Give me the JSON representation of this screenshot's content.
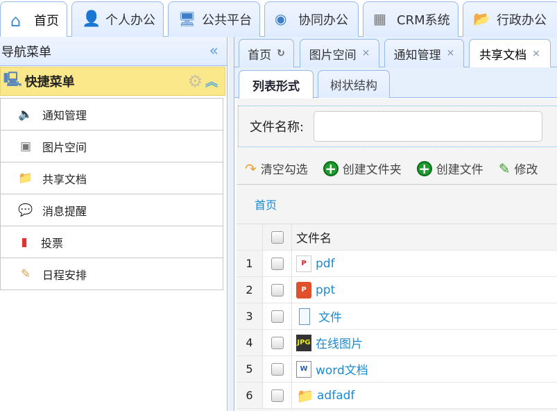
{
  "top_tabs": [
    "首页",
    "个人办公",
    "公共平台",
    "协同办公",
    "CRM系统",
    "行政办公"
  ],
  "left": {
    "title": "导航菜单",
    "quick_menu": "快捷菜单",
    "items": [
      "通知管理",
      "图片空间",
      "共享文档",
      "消息提醒",
      "投票",
      "日程安排"
    ]
  },
  "content_tabs": [
    "首页",
    "图片空间",
    "通知管理",
    "共享文档"
  ],
  "sub_tabs": [
    "列表形式",
    "树状结构"
  ],
  "search": {
    "label": "文件名称:",
    "value": ""
  },
  "toolbar": [
    "清空勾选",
    "创建文件夹",
    "创建文件",
    "修改"
  ],
  "breadcrumb": "首页",
  "table": {
    "header": "文件名",
    "rows": [
      {
        "num": "1",
        "name": "pdf",
        "type": "pdf"
      },
      {
        "num": "2",
        "name": "ppt",
        "type": "ppt"
      },
      {
        "num": "3",
        "name": "文件",
        "type": "file"
      },
      {
        "num": "4",
        "name": "在线图片",
        "type": "jpg"
      },
      {
        "num": "5",
        "name": "word文档",
        "type": "word"
      },
      {
        "num": "6",
        "name": "adfadf",
        "type": "folder"
      }
    ]
  }
}
